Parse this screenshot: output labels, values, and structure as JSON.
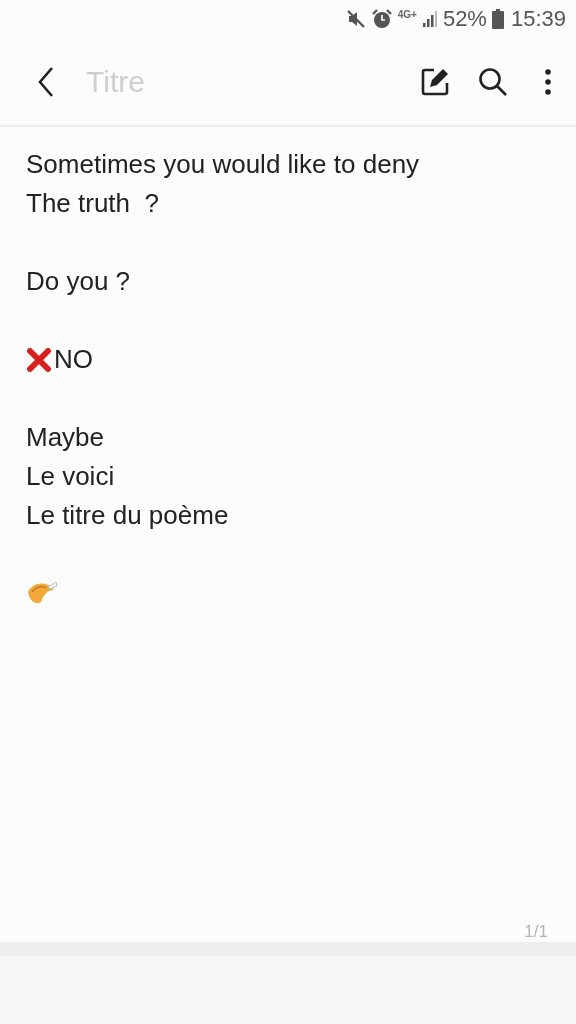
{
  "status_bar": {
    "network": "4G+",
    "battery": "52%",
    "time": "15:39"
  },
  "toolbar": {
    "title_placeholder": "Titre"
  },
  "note_lines": [
    {
      "kind": "text",
      "text": "Sometimes you would like to deny"
    },
    {
      "kind": "text",
      "text": "The truth  ?"
    },
    {
      "kind": "blank"
    },
    {
      "kind": "text",
      "text": "Do you ?"
    },
    {
      "kind": "blank"
    },
    {
      "kind": "cross",
      "text": "NO"
    },
    {
      "kind": "blank"
    },
    {
      "kind": "text",
      "text": "Maybe"
    },
    {
      "kind": "text",
      "text": "Le voici"
    },
    {
      "kind": "text",
      "text": "Le titre du poème"
    },
    {
      "kind": "blank"
    },
    {
      "kind": "cookie"
    }
  ],
  "page_indicator": "1/1"
}
